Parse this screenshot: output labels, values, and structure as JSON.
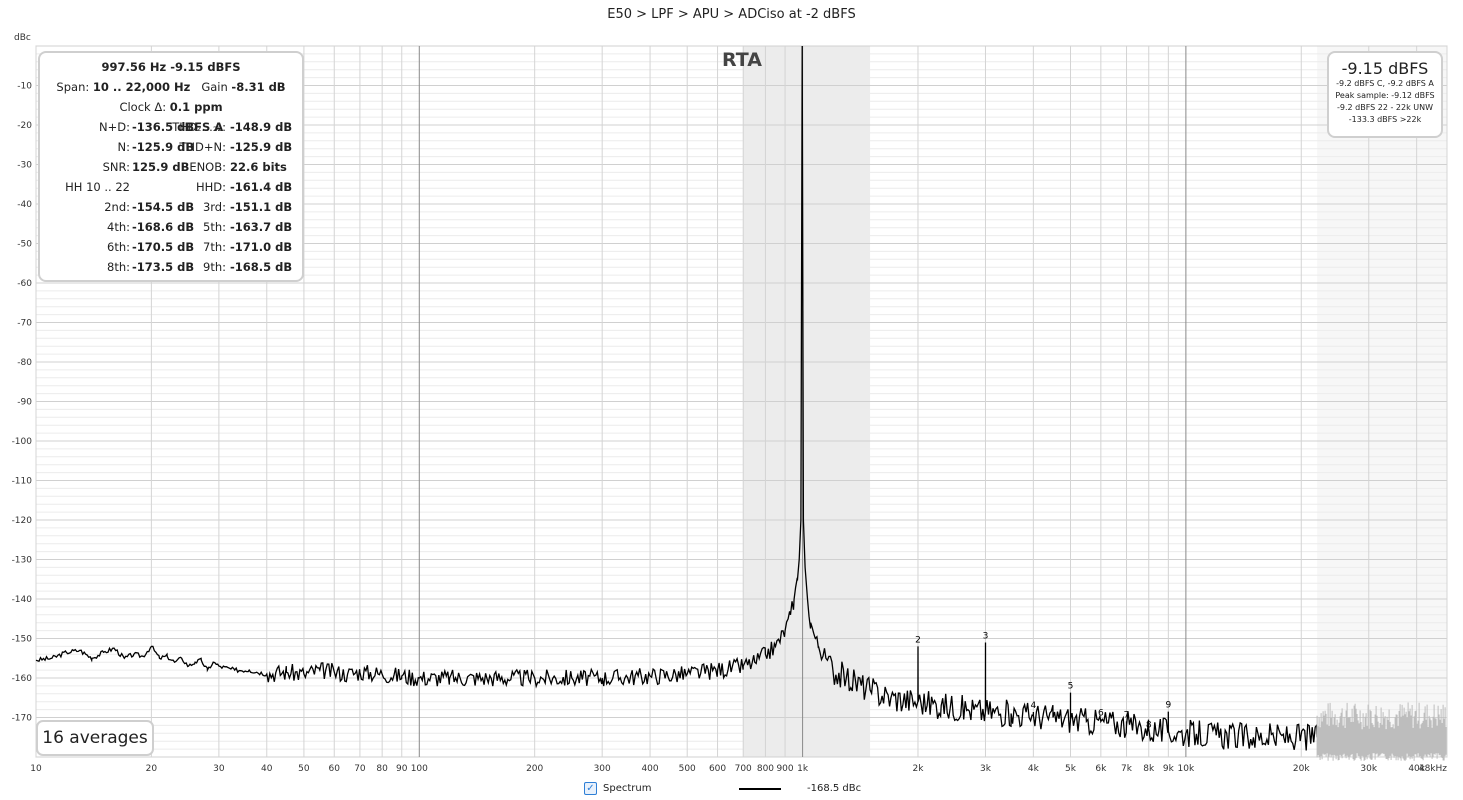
{
  "title": "E50 > LPF > APU > ADCiso at -2 dBFS",
  "stats": {
    "line1": "997.56 Hz  -9.15 dBFS",
    "span_label": "Span:",
    "span_value": "10 .. 22,000 Hz",
    "gain_label": "Gain",
    "gain_value": "-8.31 dB",
    "clock_label": "Clock Δ:",
    "clock_value": "0.1 ppm",
    "rows": [
      {
        "l": "N+D:",
        "lv": "-136.5 dBFS A",
        "r": "THD₂…₂₂:",
        "rv": "-148.9 dB"
      },
      {
        "l": "N:",
        "lv": "-125.9 dB",
        "r": "THD+N:",
        "rv": "-125.9 dB"
      },
      {
        "l": "SNR:",
        "lv": "125.9 dB",
        "r": "ENOB:",
        "rv": "22.6 bits"
      },
      {
        "l": "HH 10 .. 22",
        "lv": "",
        "r": "HHD:",
        "rv": "-161.4 dB"
      },
      {
        "l": "2nd:",
        "lv": "-154.5 dB",
        "r": "3rd:",
        "rv": "-151.1 dB"
      },
      {
        "l": "4th:",
        "lv": "-168.6 dB",
        "r": "5th:",
        "rv": "-163.7 dB"
      },
      {
        "l": "6th:",
        "lv": "-170.5 dB",
        "r": "7th:",
        "rv": "-171.0 dB"
      },
      {
        "l": "8th:",
        "lv": "-173.5 dB",
        "r": "9th:",
        "rv": "-168.5 dB"
      }
    ]
  },
  "level": {
    "main": "-9.15 dBFS",
    "lines": [
      "-9.2 dBFS C, -9.2 dBFS A",
      "Peak sample: -9.12 dBFS",
      "-9.2 dBFS 22 - 22k UNW",
      "-133.3 dBFS >22k"
    ]
  },
  "averages": "16 averages",
  "rta": "RTA",
  "legend": {
    "checkbox": "✓",
    "label": "Spectrum",
    "value": "-168.5 dBc"
  },
  "chart_data": {
    "type": "line",
    "title": "E50 > LPF > APU > ADCiso at -2 dBFS",
    "xlabel": "",
    "ylabel": "dBc",
    "xscale": "log",
    "xlim": [
      10,
      48000
    ],
    "ylim": [
      -180,
      0
    ],
    "xticks": [
      10,
      20,
      30,
      40,
      50,
      60,
      70,
      80,
      90,
      100,
      200,
      300,
      400,
      500,
      600,
      700,
      800,
      900,
      1000,
      2000,
      3000,
      4000,
      5000,
      6000,
      7000,
      8000,
      9000,
      10000,
      20000,
      30000,
      40000,
      48000
    ],
    "xticklabels": [
      "10",
      "20",
      "30",
      "40",
      "50",
      "60",
      "70",
      "80",
      "90",
      "100",
      "200",
      "300",
      "400",
      "500",
      "600",
      "700",
      "800",
      "900",
      "1k",
      "2k",
      "3k",
      "4k",
      "5k",
      "6k",
      "7k",
      "8k",
      "9k",
      "10k",
      "20k",
      "30k",
      "40k",
      "48kHz"
    ],
    "yticks": [
      -10,
      -20,
      -30,
      -40,
      -50,
      -60,
      -70,
      -80,
      -90,
      -100,
      -110,
      -120,
      -130,
      -140,
      -150,
      -160,
      -170
    ],
    "yticklabels": [
      "-10",
      "-20",
      "-30",
      "-40",
      "-50",
      "-60",
      "-70",
      "-80",
      "-90",
      "-100",
      "-110",
      "-120",
      "-130",
      "-140",
      "-150",
      "-160",
      "-170"
    ],
    "highlight_band": [
      700,
      1500
    ],
    "excluded_above": 22000,
    "grid": true,
    "legend_position": "bottom-center",
    "series": [
      {
        "name": "Spectrum",
        "color": "#000000",
        "x": [
          10,
          11,
          12,
          13,
          14,
          15,
          16,
          17,
          18,
          19,
          20,
          21,
          22,
          23,
          24,
          25,
          26,
          27,
          28,
          29,
          30,
          33,
          36,
          40,
          45,
          50,
          55,
          60,
          65,
          70,
          80,
          90,
          100,
          120,
          150,
          200,
          250,
          300,
          400,
          500,
          600,
          700,
          750,
          800,
          850,
          900,
          930,
          950,
          970,
          980,
          990,
          997.56,
          1005,
          1015,
          1030,
          1050,
          1080,
          1100,
          1150,
          1200,
          1300,
          1500,
          1700,
          1999,
          2000,
          2001,
          2300,
          2700,
          2999,
          3000,
          3001,
          3500,
          3999,
          4000,
          4001,
          4500,
          4999,
          5000,
          5001,
          5500,
          5999,
          6000,
          6001,
          6500,
          6999,
          7000,
          7001,
          7500,
          7999,
          8000,
          8001,
          8500,
          8999,
          9000,
          9001,
          9500,
          10000,
          12000,
          15000,
          18000,
          22000
        ],
        "y": [
          -155.5,
          -155,
          -153.5,
          -153,
          -155,
          -153.5,
          -152.5,
          -155,
          -154,
          -154.5,
          -152,
          -155,
          -154.5,
          -156,
          -155,
          -157,
          -156,
          -155.5,
          -158,
          -156,
          -157,
          -158,
          -158,
          -159,
          -158.5,
          -159,
          -158,
          -158.5,
          -159,
          -158.5,
          -159,
          -159.5,
          -160,
          -160,
          -160,
          -160,
          -160,
          -160,
          -159.5,
          -159,
          -158,
          -157,
          -156,
          -154,
          -152,
          -148,
          -144,
          -140,
          -135,
          -130,
          -120,
          0,
          -120,
          -132,
          -140,
          -146,
          -150,
          -152,
          -155,
          -158,
          -160,
          -163,
          -165,
          -166,
          -152,
          -166,
          -167,
          -168,
          -168.5,
          -151,
          -168.5,
          -169,
          -169.5,
          -168.6,
          -169.5,
          -170,
          -170.5,
          -163.7,
          -170.5,
          -171,
          -171,
          -170.5,
          -171,
          -171.5,
          -172,
          -171,
          -172,
          -172.5,
          -173,
          -173.5,
          -173,
          -173.5,
          -173.5,
          -168.5,
          -173.5,
          -174,
          -174,
          -174.5,
          -175,
          -175,
          -175
        ]
      },
      {
        "name": "",
        "color": "#bdbdbd",
        "x": [
          22000,
          48000
        ],
        "y": [
          -175,
          -175
        ]
      }
    ],
    "annotations": [
      {
        "text": "2",
        "x": 2000,
        "y": -152
      },
      {
        "text": "3",
        "x": 3000,
        "y": -151
      },
      {
        "text": "4",
        "x": 4000,
        "y": -168.6
      },
      {
        "text": "5",
        "x": 5000,
        "y": -163.7
      },
      {
        "text": "6",
        "x": 6000,
        "y": -170.5
      },
      {
        "text": "7",
        "x": 7000,
        "y": -171
      },
      {
        "text": "8",
        "x": 8000,
        "y": -173.5
      },
      {
        "text": "9",
        "x": 9000,
        "y": -168.5
      }
    ]
  }
}
